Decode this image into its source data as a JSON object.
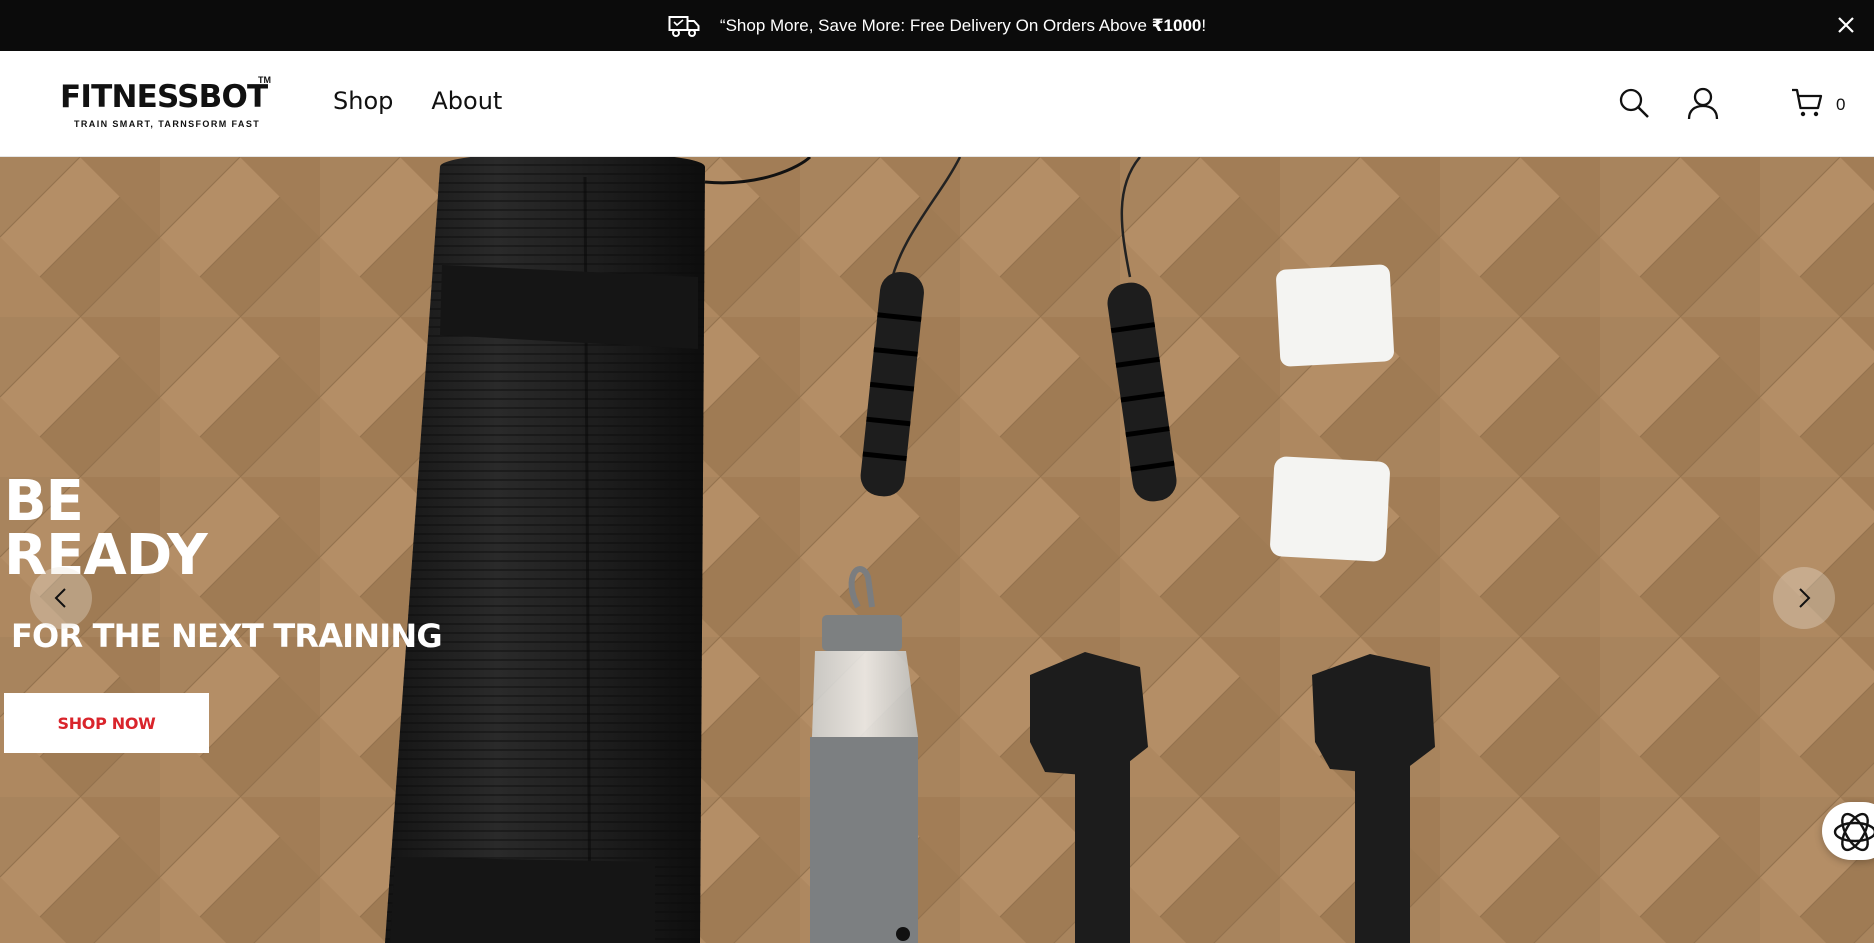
{
  "announcement": {
    "text_prefix": "“Shop More, Save More: Free Delivery On Orders Above ",
    "amount": "₹1000",
    "text_suffix": "!",
    "icon": "delivery-truck-icon",
    "close_icon": "close-icon"
  },
  "header": {
    "logo": {
      "name": "FITNESSBOT",
      "tm": "TM",
      "tagline": "TRAIN SMART, TARNSFORM FAST"
    },
    "nav": [
      {
        "label": "Shop"
      },
      {
        "label": "About"
      }
    ],
    "icons": [
      "search-icon",
      "account-icon",
      "cart-icon"
    ],
    "cart_count": "0"
  },
  "hero": {
    "title_line1": "BE",
    "title_line2": "READY",
    "subtitle": "FOR THE NEXT TRAINING",
    "cta_label": "SHOP NOW",
    "prev_icon": "chevron-left-icon",
    "next_icon": "chevron-right-icon",
    "slide_index": 1
  },
  "colors": {
    "announce_bg": "#0b0b0b",
    "cta_text": "#d9242b",
    "hero_floor": "#a7835d"
  }
}
